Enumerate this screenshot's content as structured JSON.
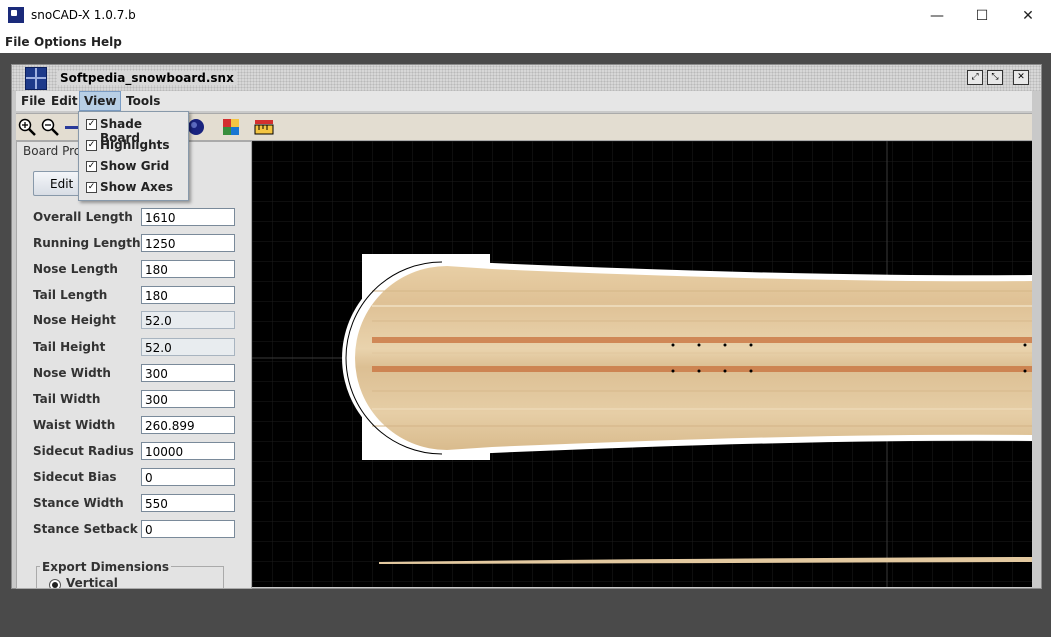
{
  "window": {
    "title": "snoCAD-X 1.0.7.b",
    "minimize": "—",
    "maximize": "☐",
    "close": "✕"
  },
  "menubar": [
    "File",
    "Options",
    "Help"
  ],
  "document": {
    "title": "Softpedia_snowboard.snx",
    "controls": [
      "⤢",
      "⤡",
      "✕"
    ]
  },
  "inner_menu": [
    "File",
    "Edit",
    "View",
    "Tools"
  ],
  "view_menu": {
    "items": [
      {
        "label": "Shade Board",
        "checked": true
      },
      {
        "label": "Highlights",
        "checked": true
      },
      {
        "label": "Show Grid",
        "checked": true
      },
      {
        "label": "Show Axes",
        "checked": true
      }
    ]
  },
  "toolbar": {
    "icons": [
      "zoom-in-icon",
      "zoom-out-icon",
      "pan-icon",
      "view-3d-icon",
      "color-palette-icon",
      "ruler-icon"
    ]
  },
  "panel": {
    "title": "Board Pro",
    "edit_button": "Edit B",
    "properties": [
      {
        "label": "Overall Length",
        "value": "1610",
        "disabled": false
      },
      {
        "label": "Running Length",
        "value": "1250",
        "disabled": false
      },
      {
        "label": "Nose Length",
        "value": "180",
        "disabled": false
      },
      {
        "label": "Tail Length",
        "value": "180",
        "disabled": false
      },
      {
        "label": "Nose Height",
        "value": "52.0",
        "disabled": true
      },
      {
        "label": "Tail Height",
        "value": "52.0",
        "disabled": true
      },
      {
        "label": "Nose Width",
        "value": "300",
        "disabled": false
      },
      {
        "label": "Tail Width",
        "value": "300",
        "disabled": false
      },
      {
        "label": "Waist Width",
        "value": "260.899",
        "disabled": false
      },
      {
        "label": "Sidecut Radius",
        "value": "10000",
        "disabled": false
      },
      {
        "label": "Sidecut Bias",
        "value": "0",
        "disabled": false
      },
      {
        "label": "Stance Width",
        "value": "550",
        "disabled": false
      },
      {
        "label": "Stance Setback",
        "value": "0",
        "disabled": false
      }
    ],
    "export": {
      "title": "Export Dimensions",
      "option": "Vertical"
    }
  }
}
